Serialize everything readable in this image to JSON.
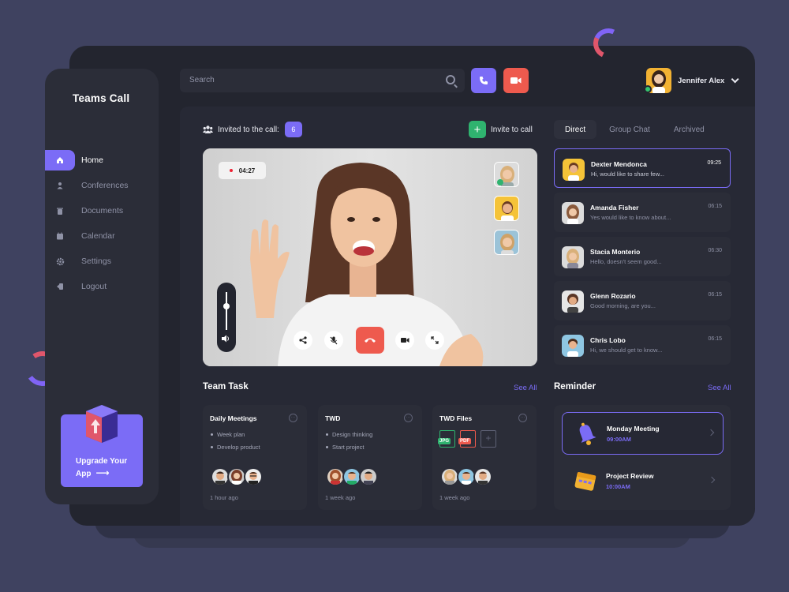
{
  "app": {
    "title": "Teams Call"
  },
  "sidebar": {
    "items": [
      {
        "label": "Home",
        "icon": "home-icon",
        "active": true
      },
      {
        "label": "Conferences",
        "icon": "user-icon",
        "active": false
      },
      {
        "label": "Documents",
        "icon": "trash-icon",
        "active": false
      },
      {
        "label": "Calendar",
        "icon": "calendar-icon",
        "active": false
      },
      {
        "label": "Settings",
        "icon": "gear-icon",
        "active": false
      },
      {
        "label": "Logout",
        "icon": "logout-icon",
        "active": false
      }
    ],
    "upgrade": {
      "line1": "Upgrade Your",
      "line2": "App",
      "arrow": "⟶"
    }
  },
  "header": {
    "search_placeholder": "Search",
    "user_name": "Jennifer Alex"
  },
  "call": {
    "invited_label": "Invited to the call:",
    "invited_count": "6",
    "invite_button": "Invite to call",
    "timer": "04:27"
  },
  "chat": {
    "tabs": [
      "Direct",
      "Group Chat",
      "Archived"
    ],
    "active_tab": "Direct",
    "messages": [
      {
        "name": "Dexter Mendonca",
        "text": "Hi, would like to share few...",
        "time": "09:25",
        "active": true
      },
      {
        "name": "Amanda Fisher",
        "text": "Yes would like to know about...",
        "time": "06:15",
        "active": false
      },
      {
        "name": "Stacia Monterio",
        "text": "Hello, doesn't seem good...",
        "time": "06:30",
        "active": false
      },
      {
        "name": "Glenn Rozario",
        "text": "Good morning, are you...",
        "time": "06:15",
        "active": false
      },
      {
        "name": "Chris Lobo",
        "text": "Hi, we should get to know...",
        "time": "06:15",
        "active": false
      }
    ]
  },
  "team_task": {
    "title": "Team Task",
    "see_all": "See All",
    "cards": [
      {
        "title": "Daily Meetings",
        "items": [
          "Week plan",
          "Develop product"
        ],
        "ago": "1 hour ago"
      },
      {
        "title": "TWD",
        "items": [
          "Design thinking",
          "Start project"
        ],
        "ago": "1 week ago"
      },
      {
        "title": "TWD Files",
        "files": [
          "JPG",
          "PDF"
        ],
        "ago": "1 week ago"
      }
    ]
  },
  "reminder": {
    "title": "Reminder",
    "see_all": "See All",
    "items": [
      {
        "name": "Monday Meeting",
        "time": "09:00AM",
        "active": true
      },
      {
        "name": "Project Review",
        "time": "10:00AM",
        "active": false
      }
    ]
  },
  "colors": {
    "accent": "#7b6cf6",
    "danger": "#ee5a4e",
    "success": "#2fb36f"
  }
}
